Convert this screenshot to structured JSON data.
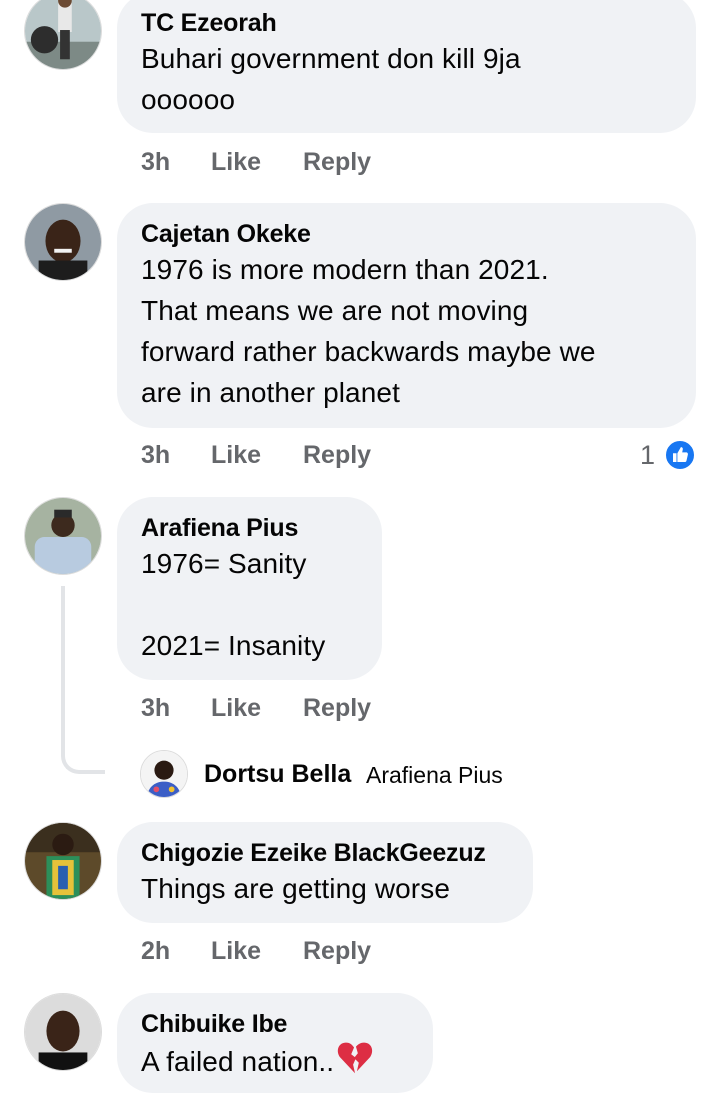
{
  "comments": [
    {
      "author": "TC Ezeorah",
      "text": "Buhari government don kill 9ja\noooooo",
      "time": "3h",
      "like": "Like",
      "reply": "Reply"
    },
    {
      "author": "Cajetan Okeke",
      "text": "1976 is more modern than 2021.\nThat means we are not moving\nforward rather backwards maybe we\nare in another planet",
      "time": "3h",
      "like": "Like",
      "reply": "Reply",
      "reaction_count": "1",
      "reaction_icon": "thumbs-up-icon",
      "reaction_color": "#1877f2"
    },
    {
      "author": "Arafiena Pius",
      "text": "1976= Sanity\n\n2021= Insanity",
      "time": "3h",
      "like": "Like",
      "reply": "Reply",
      "reply_preview": {
        "author": "Dortsu Bella",
        "tag": "Arafiena Pius"
      }
    },
    {
      "author": "Chigozie Ezeike BlackGeezuz",
      "text": "Things are getting worse",
      "time": "2h",
      "like": "Like",
      "reply": "Reply"
    },
    {
      "author": "Chibuike Ibe",
      "text": "A failed nation..",
      "emoji": "broken-heart-icon"
    }
  ],
  "colors": {
    "bubble": "#f0f2f5",
    "meta_text": "#65676b",
    "accent": "#1877f2",
    "broken_heart": "#dd2e44"
  }
}
